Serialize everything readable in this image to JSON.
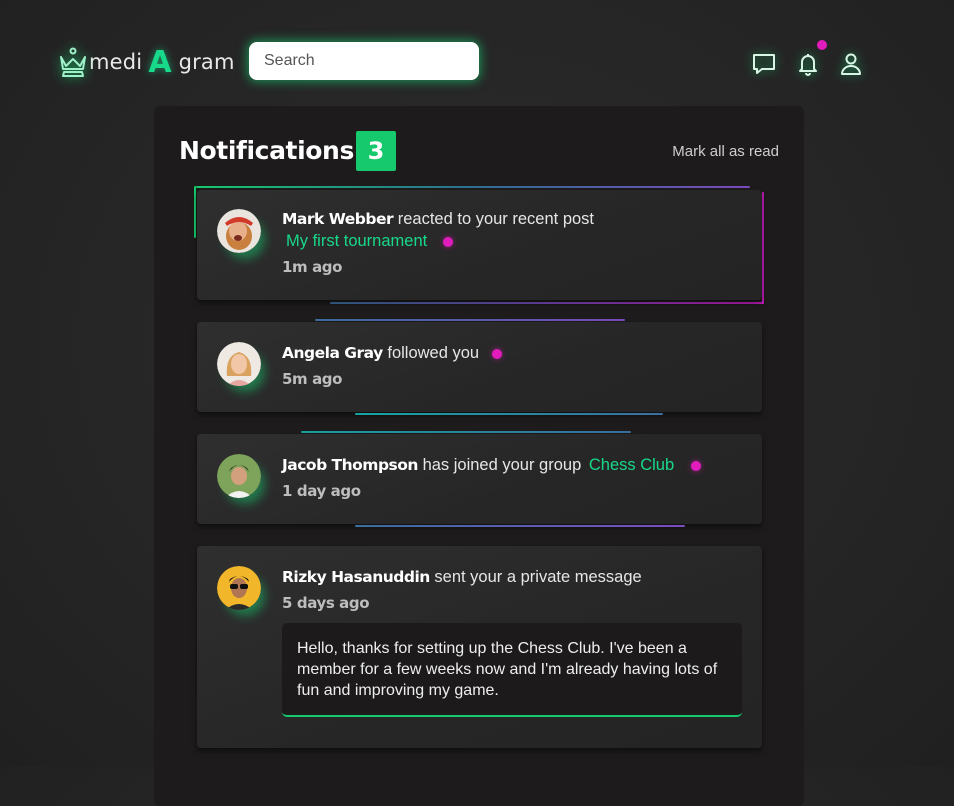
{
  "header": {
    "logo_prefix": "medi",
    "logo_big": "A",
    "logo_suffix": "gram",
    "search_placeholder": "Search",
    "icons": [
      "chat-bubble-icon",
      "bell-icon",
      "user-icon"
    ],
    "has_unread_indicator": true
  },
  "notifications": {
    "title": "Notifications",
    "count": "3",
    "mark_all_label": "Mark all as read",
    "items": [
      {
        "name": "Mark Webber",
        "action": "reacted to your recent post",
        "target": "My first tournament",
        "time": "1m ago",
        "unread": true
      },
      {
        "name": "Angela Gray",
        "action": "followed you",
        "target": "",
        "time": "5m ago",
        "unread": true
      },
      {
        "name": "Jacob Thompson",
        "action": "has joined your group",
        "target": "Chess Club",
        "time": "1 day ago",
        "unread": true
      },
      {
        "name": "Rizky Hasanuddin",
        "action": "sent your a private message",
        "target": "",
        "time": "5 days ago",
        "unread": false,
        "message": "Hello, thanks for setting up the Chess Club. I've been a member for a few weeks now and I'm already having lots of fun and improving my game."
      }
    ]
  },
  "colors": {
    "accent": "#18d98a",
    "unread_dot": "#e21bbd",
    "panel": "#1d1b1b",
    "background": "#262626"
  }
}
